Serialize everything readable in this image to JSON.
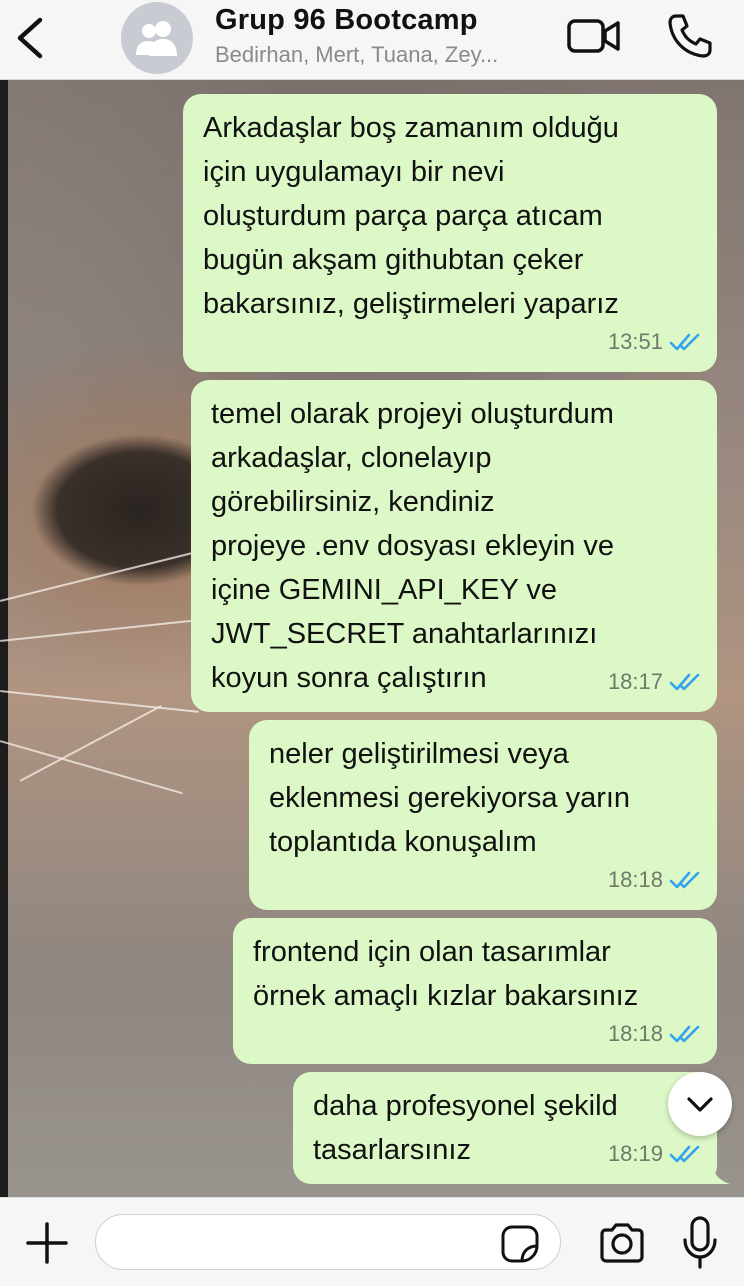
{
  "header": {
    "title": "Grup 96 Bootcamp",
    "subtitle": "Bedirhan, Mert, Tuana, Zey...",
    "icons": {
      "back": "chevron-left-icon",
      "avatar": "group-icon",
      "video": "video-camera-icon",
      "call": "phone-icon"
    }
  },
  "messages": [
    {
      "text": "Arkadaşlar boş zamanım olduğu\niçin uygulamayı bir nevi\noluşturdum parça parça atıcam\nbugün akşam githubtan çeker\nbakarsınız, geliştirmeleri yaparız",
      "time": "13:51",
      "status": "read"
    },
    {
      "text": "temel olarak projeyi oluşturdum\narkadaşlar, clonelayıp\ngörebilirsiniz, kendiniz\nprojeye .env dosyası ekleyin ve\niçine GEMINI_API_KEY ve\nJWT_SECRET anahtarlarınızı\nkoyun sonra çalıştırın",
      "time": "18:17",
      "status": "read"
    },
    {
      "text": "neler geliştirilmesi veya\neklenmesi gerekiyorsa yarın\ntoplantıda konuşalım",
      "time": "18:18",
      "status": "read"
    },
    {
      "text": "frontend için olan tasarımlar\nörnek amaçlı kızlar bakarsınız",
      "time": "18:18",
      "status": "read"
    },
    {
      "text": "daha profesyonel şekild\ntasarlarsınız",
      "time": "18:19",
      "status": "read"
    }
  ],
  "input": {
    "value": "",
    "placeholder": "",
    "icons": {
      "attach": "plus-icon",
      "sticker": "sticker-icon",
      "camera": "camera-icon",
      "mic": "microphone-icon",
      "scroll": "chevron-down-icon"
    }
  },
  "colors": {
    "outgoing_bubble": "#dcf8c6",
    "read_ticks": "#34a2f0",
    "time_text": "#6f7a6a"
  }
}
